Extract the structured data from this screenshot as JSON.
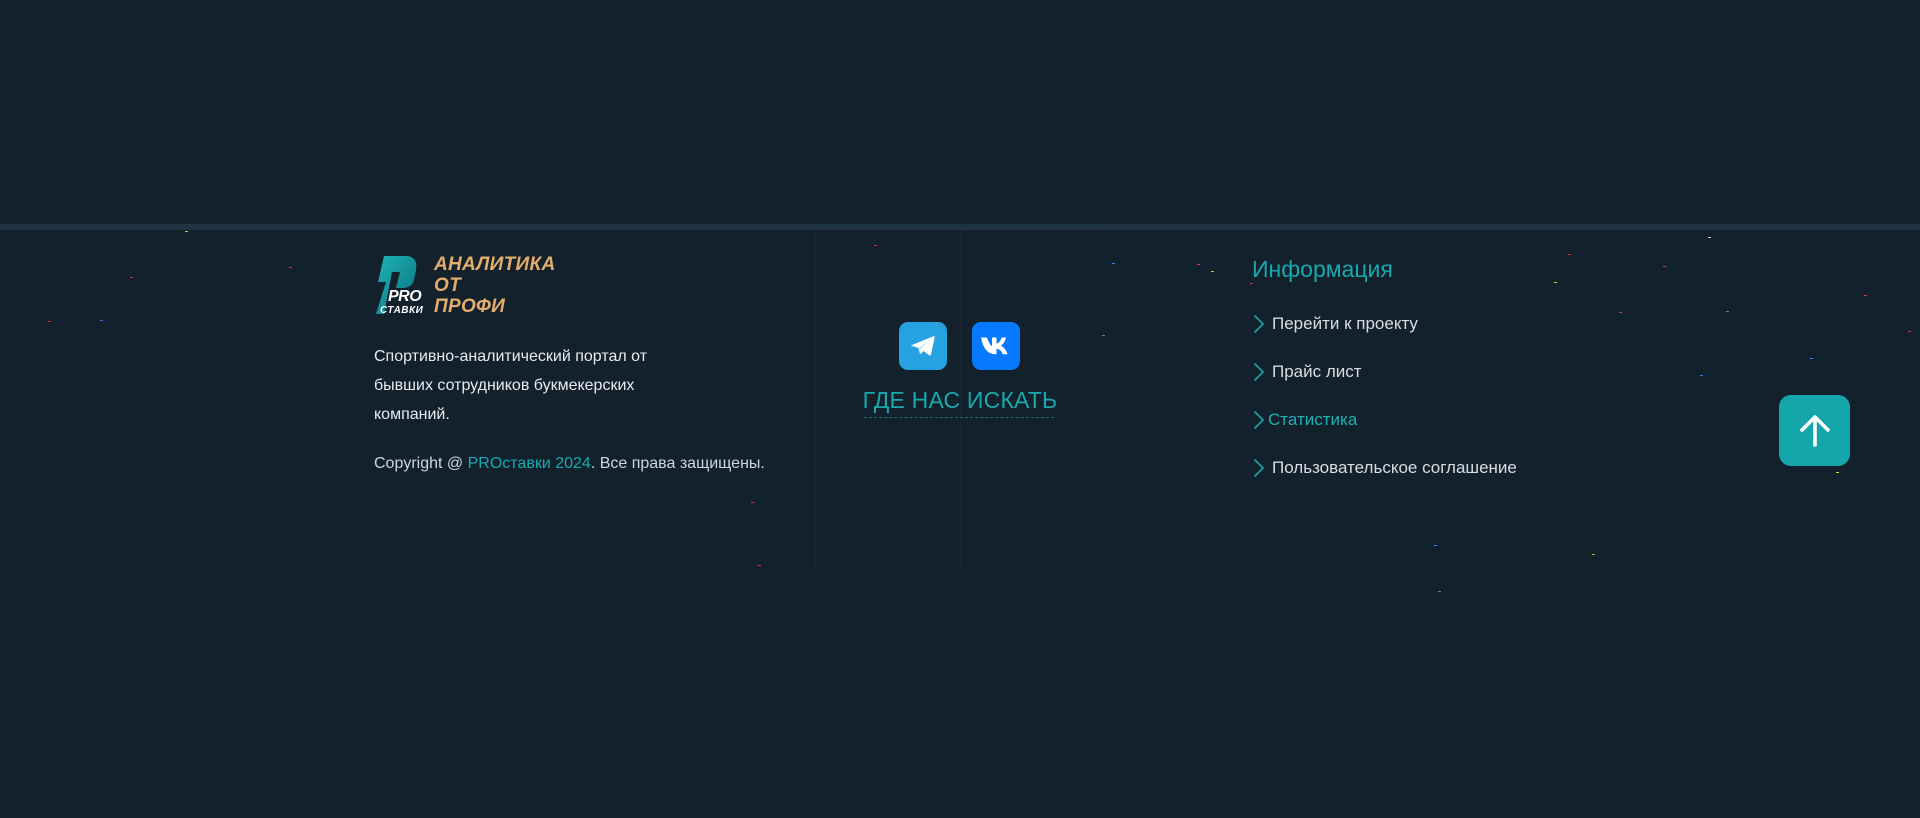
{
  "colors": {
    "background": "#13212c",
    "divider": "#1f3442",
    "accent": "#18a8ad",
    "logo_text": "#e3ad6d",
    "telegram": "#27a2e0",
    "vk": "#0779ff"
  },
  "logo": {
    "pro": "PRO",
    "stavki": "СТАВКИ",
    "tagline": [
      "АНАЛИТИКА",
      "ОТ",
      "ПРОФИ"
    ]
  },
  "about": {
    "description": "Спортивно-аналитический портал от бывших сотрудников букмекерских компаний."
  },
  "copyright": {
    "prefix": "Copyright @ ",
    "brand": "PROставки 2024",
    "suffix": ". Все права защищены."
  },
  "social": {
    "items": [
      {
        "icon": "telegram-icon"
      },
      {
        "icon": "vk-icon"
      }
    ],
    "heading": "ГДЕ НАС ИСКАТЬ"
  },
  "info": {
    "title": "Информация",
    "items": [
      {
        "label": "Перейти к проекту",
        "active": false
      },
      {
        "label": "Прайс лист",
        "active": false
      },
      {
        "label": "Статистика",
        "active": true
      },
      {
        "label": "Пользовательское соглашение",
        "active": false
      }
    ]
  },
  "scroll_up": {
    "icon": "arrow-up-icon"
  }
}
